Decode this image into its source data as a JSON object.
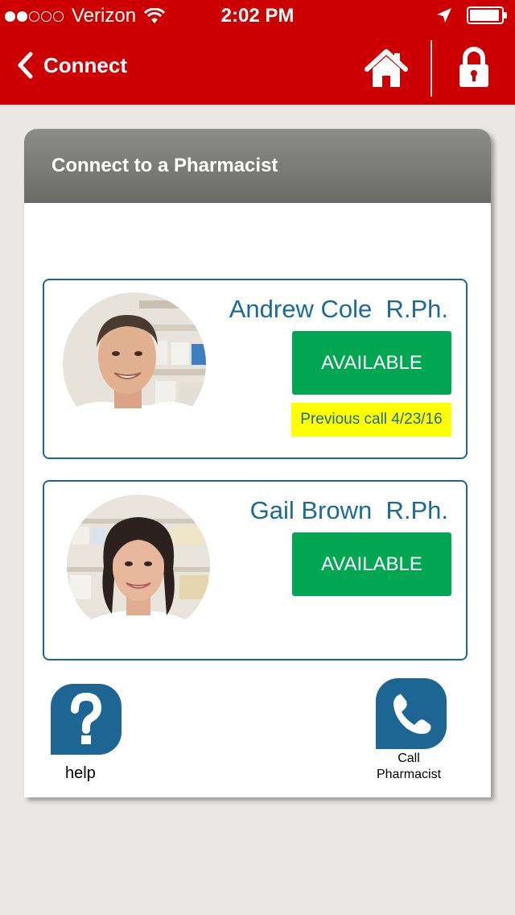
{
  "status_bar": {
    "carrier": "Verizon",
    "time": "2:02 PM",
    "signal_dots_filled": 2,
    "signal_dots_total": 5
  },
  "nav": {
    "back_icon": "chevron-left-icon",
    "title": "Connect",
    "home_icon": "home-icon",
    "lock_icon": "lock-icon"
  },
  "panel": {
    "title": "Connect to a Pharmacist"
  },
  "pharmacists": [
    {
      "first": "Andrew Cole",
      "suffix": "R.Ph.",
      "status": "AVAILABLE",
      "previous_call": "Previous call 4/23/16"
    },
    {
      "first": "Gail Brown",
      "suffix": "R.Ph.",
      "status": "AVAILABLE"
    }
  ],
  "actions": {
    "help_label": "help",
    "help_icon": "question-mark-icon",
    "call_label_line1": "Call",
    "call_label_line2": "Pharmacist",
    "call_icon": "phone-icon"
  },
  "colors": {
    "brand_red": "#cc0000",
    "accent_blue": "#1d6694",
    "available_green": "#00a651",
    "highlight_yellow": "#ffff00"
  }
}
